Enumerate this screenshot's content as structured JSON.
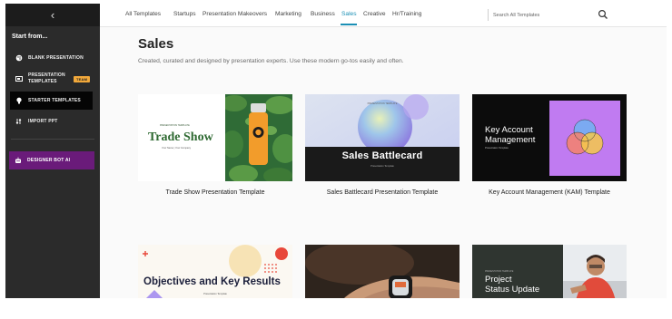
{
  "sidebar": {
    "start_from": "Start from...",
    "items": [
      {
        "label": "BLANK PRESENTATION"
      },
      {
        "label": "PRESENTATION TEMPLATES",
        "badge": "TEAM"
      },
      {
        "label": "STARTER TEMPLATES",
        "active": true
      },
      {
        "label": "IMPORT PPT"
      }
    ],
    "bot_label": "DESIGNER BOT AI"
  },
  "nav": {
    "tabs": [
      {
        "label": "All Templates"
      },
      {
        "label": "Startups"
      },
      {
        "label": "Presentation Makeovers"
      },
      {
        "label": "Marketing"
      },
      {
        "label": "Business"
      },
      {
        "label": "Sales",
        "active": true
      },
      {
        "label": "Creative"
      },
      {
        "label": "Hr/Training"
      }
    ],
    "search_placeholder": "Search All Templates"
  },
  "main": {
    "title": "Sales",
    "subtitle": "Created, curated and designed by presentation experts. Use these modern go-tos easily and often.",
    "cards": [
      {
        "caption": "Trade Show Presentation Template",
        "thumb_small": "PRESENTATION TEMPLATE",
        "thumb_title": "Trade Show",
        "thumb_sub": "Your Name | Your Company"
      },
      {
        "caption": "Sales Battlecard Presentation Template",
        "thumb_small": "PRESENTATION TEMPLATE",
        "thumb_title": "Sales Battlecard",
        "thumb_sub": "Presentation Template"
      },
      {
        "caption": "Key Account Management (KAM) Template",
        "thumb_title_line1": "Key Account",
        "thumb_title_line2": "Management",
        "thumb_sub": "Presentation Template"
      },
      {
        "thumb_title": "Objectives and Key Results",
        "thumb_sub": "Presentation Template"
      },
      {
        "thumb_title": ""
      },
      {
        "thumb_small": "PRESENTATION TEMPLATE",
        "thumb_title_line1": "Project",
        "thumb_title_line2": "Status Update"
      }
    ]
  },
  "colors": {
    "sidebar_bg": "#2b2b2b",
    "accent": "#1b8fb5",
    "bot_button": "#6a1b7a",
    "team_badge": "#f2a93b"
  }
}
